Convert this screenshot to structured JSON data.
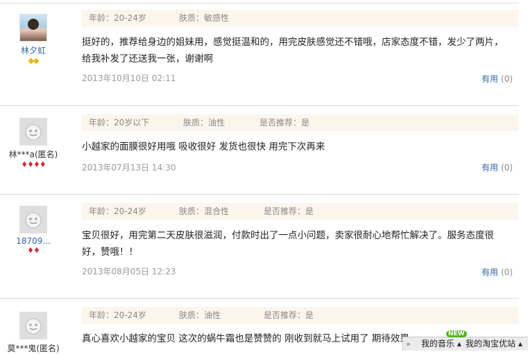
{
  "reviews": [
    {
      "username": "林夕虹",
      "rank": "◆◆",
      "age": "年龄：20-24岁",
      "skin": "肤质：敏感性",
      "recommend": "",
      "content_lines": [
        "挺好的，推荐给身边的姐妹用，感觉挺温和的，用完皮肤感觉还不错哦，店家态度不错，发少了两片，",
        "给我补发了还送我一张，谢谢啊"
      ],
      "date": "2013年10月10日 02:11",
      "useful_label": "有用",
      "useful_count": "(0)"
    },
    {
      "username": "林***a(匿名)",
      "rank": "♦♦♦♦",
      "age": "年龄：20岁以下",
      "skin": "肤质：油性",
      "recommend": "是否推荐：是",
      "content_lines": [
        "小越家的面膜很好用哦 吸收很好 发货也很快 用完下次再来"
      ],
      "date": "2013年07月13日 14:30",
      "useful_label": "有用",
      "useful_count": "(0)"
    },
    {
      "username": "18709...",
      "rank": "♦♦",
      "age": "年龄：20-24岁",
      "skin": "肤质：混合性",
      "recommend": "是否推荐：是",
      "content_lines": [
        "宝贝很好，用完第二天皮肤很滋润，付款时出了一点小问题，卖家很耐心地帮忙解决了。服务态度很",
        "好，赞哦！！"
      ],
      "date": "2013年08月05日 12:23",
      "useful_label": "有用",
      "useful_count": "(0)"
    },
    {
      "username": "莫***鬼(匿名)",
      "rank": "",
      "age": "年龄：20-24岁",
      "skin": "肤质：油性",
      "recommend": "是否推荐：是",
      "content_lines": [
        "真心喜欢小越家的宝贝 这次的蜗牛霜也是赞赞的 刚收到就马上试用了 期待效果"
      ],
      "date": "",
      "useful_label": "",
      "useful_count": ""
    }
  ],
  "toolbar": {
    "expand_icon": "double-chevron-right-icon",
    "music_label": "我的音乐",
    "new_badge": "NEW",
    "deals_label": "我的淘宝优站"
  },
  "colors": {
    "meta_bar_bg": "#fbf5ec",
    "link": "#3366aa",
    "diamond_rank": "#e8b300",
    "heart_rank": "#d4293a",
    "new_badge": "#55b12a"
  }
}
